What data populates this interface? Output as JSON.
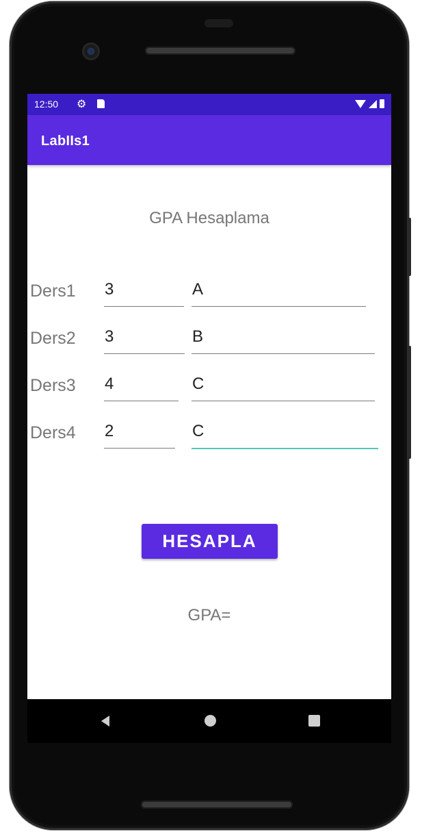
{
  "status_bar": {
    "time": "12:50"
  },
  "app_bar": {
    "title": "LabIIs1"
  },
  "heading": "GPA Hesaplama",
  "courses": [
    {
      "label": "Ders1",
      "credit": "3",
      "grade": "A"
    },
    {
      "label": "Ders2",
      "credit": "3",
      "grade": "B"
    },
    {
      "label": "Ders3",
      "credit": "4",
      "grade": "C"
    },
    {
      "label": "Ders4",
      "credit": "2",
      "grade": "C"
    }
  ],
  "calculate_button": "HESAPLA",
  "result": "GPA=",
  "icons": {
    "status": [
      "gear-icon",
      "sd-card-icon",
      "wifi-icon",
      "signal-icon",
      "battery-icon"
    ],
    "nav": [
      "back-icon",
      "home-icon",
      "recents-icon"
    ]
  },
  "colors": {
    "status_bar": "#3a1dc4",
    "app_bar": "#5a2be1",
    "button": "#5a2be1",
    "active_underline": "#54c6b6"
  }
}
